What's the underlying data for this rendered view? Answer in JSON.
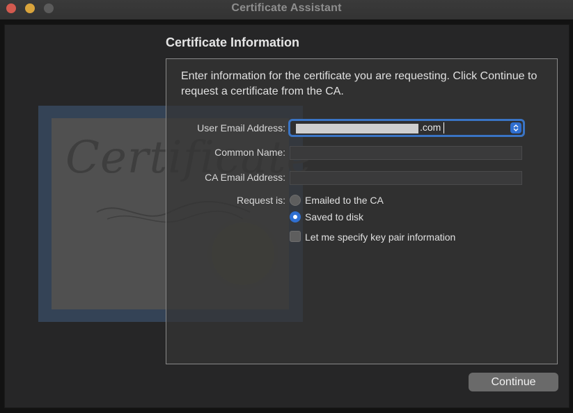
{
  "window": {
    "title": "Certificate Assistant"
  },
  "section": {
    "title": "Certificate Information"
  },
  "intro": "Enter information for the certificate you are requesting. Click Continue to request a certificate from the CA.",
  "artwork": {
    "script_text": "Certificate"
  },
  "form": {
    "user_email_label": "User Email Address:",
    "user_email_value_suffix": ".com",
    "common_name_label": "Common Name:",
    "common_name_value": "",
    "ca_email_label": "CA Email Address:",
    "ca_email_value": "",
    "request_label": "Request is:",
    "options": [
      {
        "label": "Emailed to the CA",
        "selected": false
      },
      {
        "label": "Saved to disk",
        "selected": true
      }
    ],
    "keypair_label": "Let me specify key pair information",
    "keypair_checked": false
  },
  "buttons": {
    "continue_label": "Continue"
  },
  "colors": {
    "accent": "#2f6fd1",
    "focus_ring": "#3a74c4",
    "close": "#d35a4f",
    "minimize": "#d9a43c"
  },
  "icons": {
    "combo": "chevron-up-down-icon",
    "traffic": [
      "close-icon",
      "minimize-icon",
      "zoom-icon"
    ]
  }
}
